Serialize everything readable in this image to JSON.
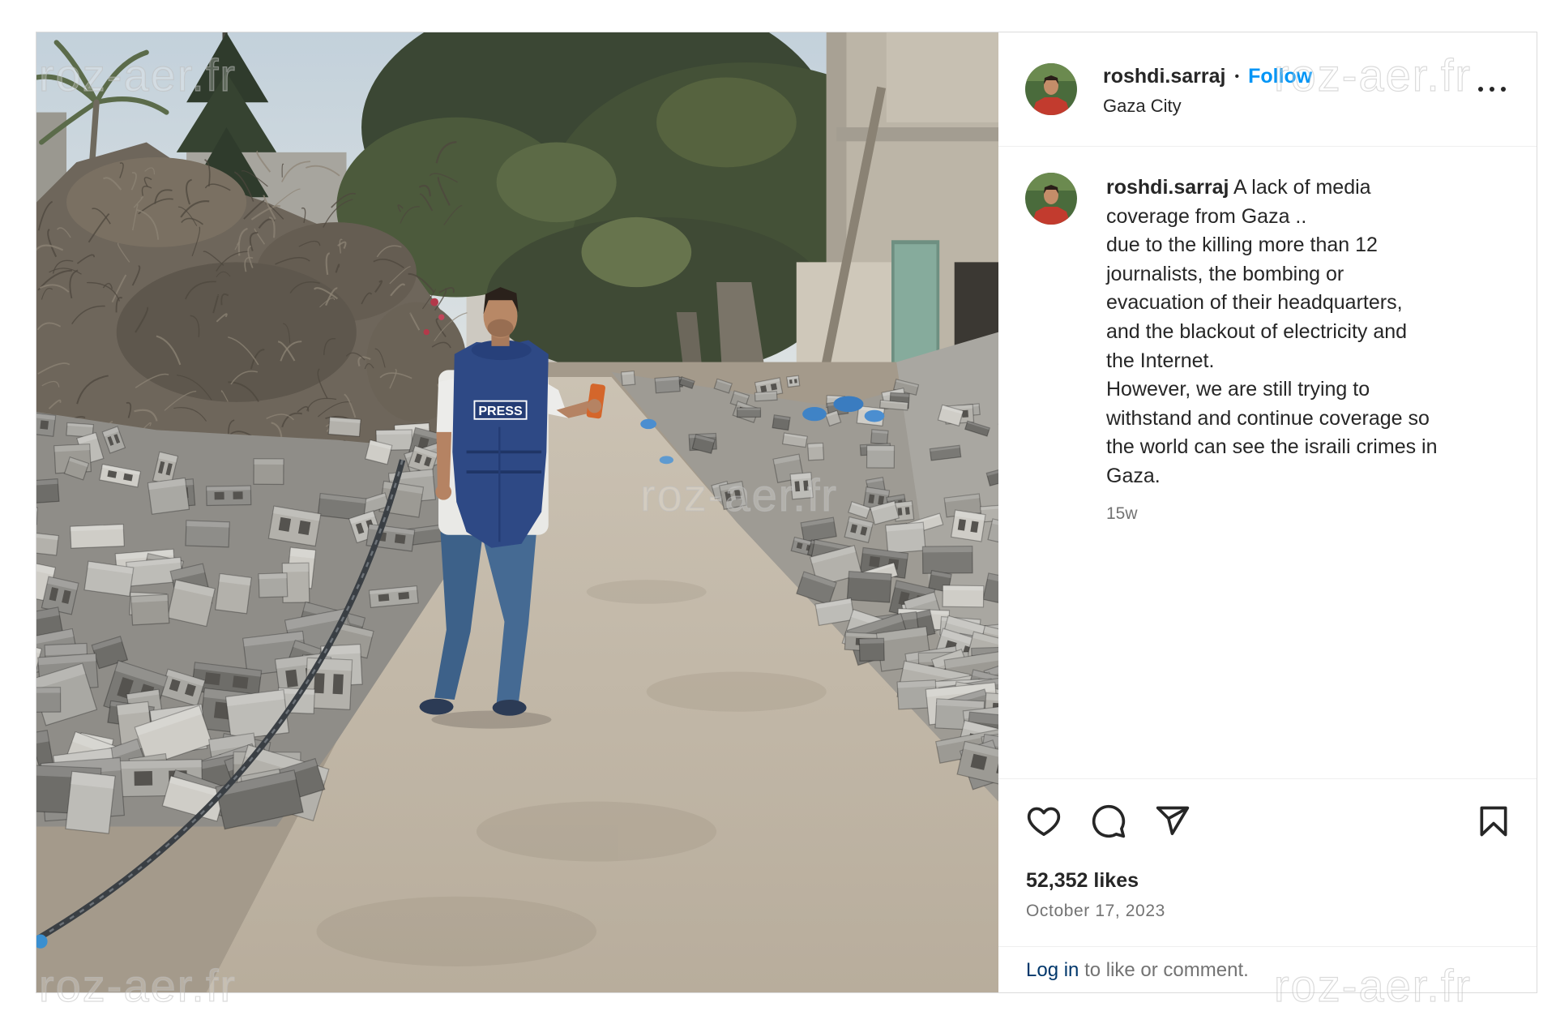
{
  "post": {
    "username": "roshdi.sarraj",
    "separator": "•",
    "follow_label": "Follow",
    "location": "Gaza City",
    "more_icon": "more-options-icon"
  },
  "caption": {
    "username": "roshdi.sarraj",
    "lines": [
      "A lack of media",
      "coverage from Gaza ..",
      "due to the killing more than 12",
      "journalists, the bombing or",
      "evacuation of their headquarters,",
      "and the blackout of electricity and",
      "the Internet.",
      "However, we are still trying to",
      "withstand and continue coverage so",
      "the world can see the israili crimes in",
      "Gaza."
    ],
    "age": "15w"
  },
  "actions": {
    "like": "heart-icon",
    "comment": "comment-icon",
    "share": "share-icon",
    "save": "bookmark-icon"
  },
  "likes": "52,352 likes",
  "date": "October 17, 2023",
  "login_prompt": {
    "link": "Log in",
    "text": "to like or comment."
  },
  "photo": {
    "vest_label": "PRESS"
  },
  "watermark": "roz-aer.fr",
  "colors": {
    "text": "#262626",
    "muted": "#737373",
    "follow_blue": "#0095f6",
    "login_blue": "#00376b",
    "border": "#dbdbdb"
  }
}
